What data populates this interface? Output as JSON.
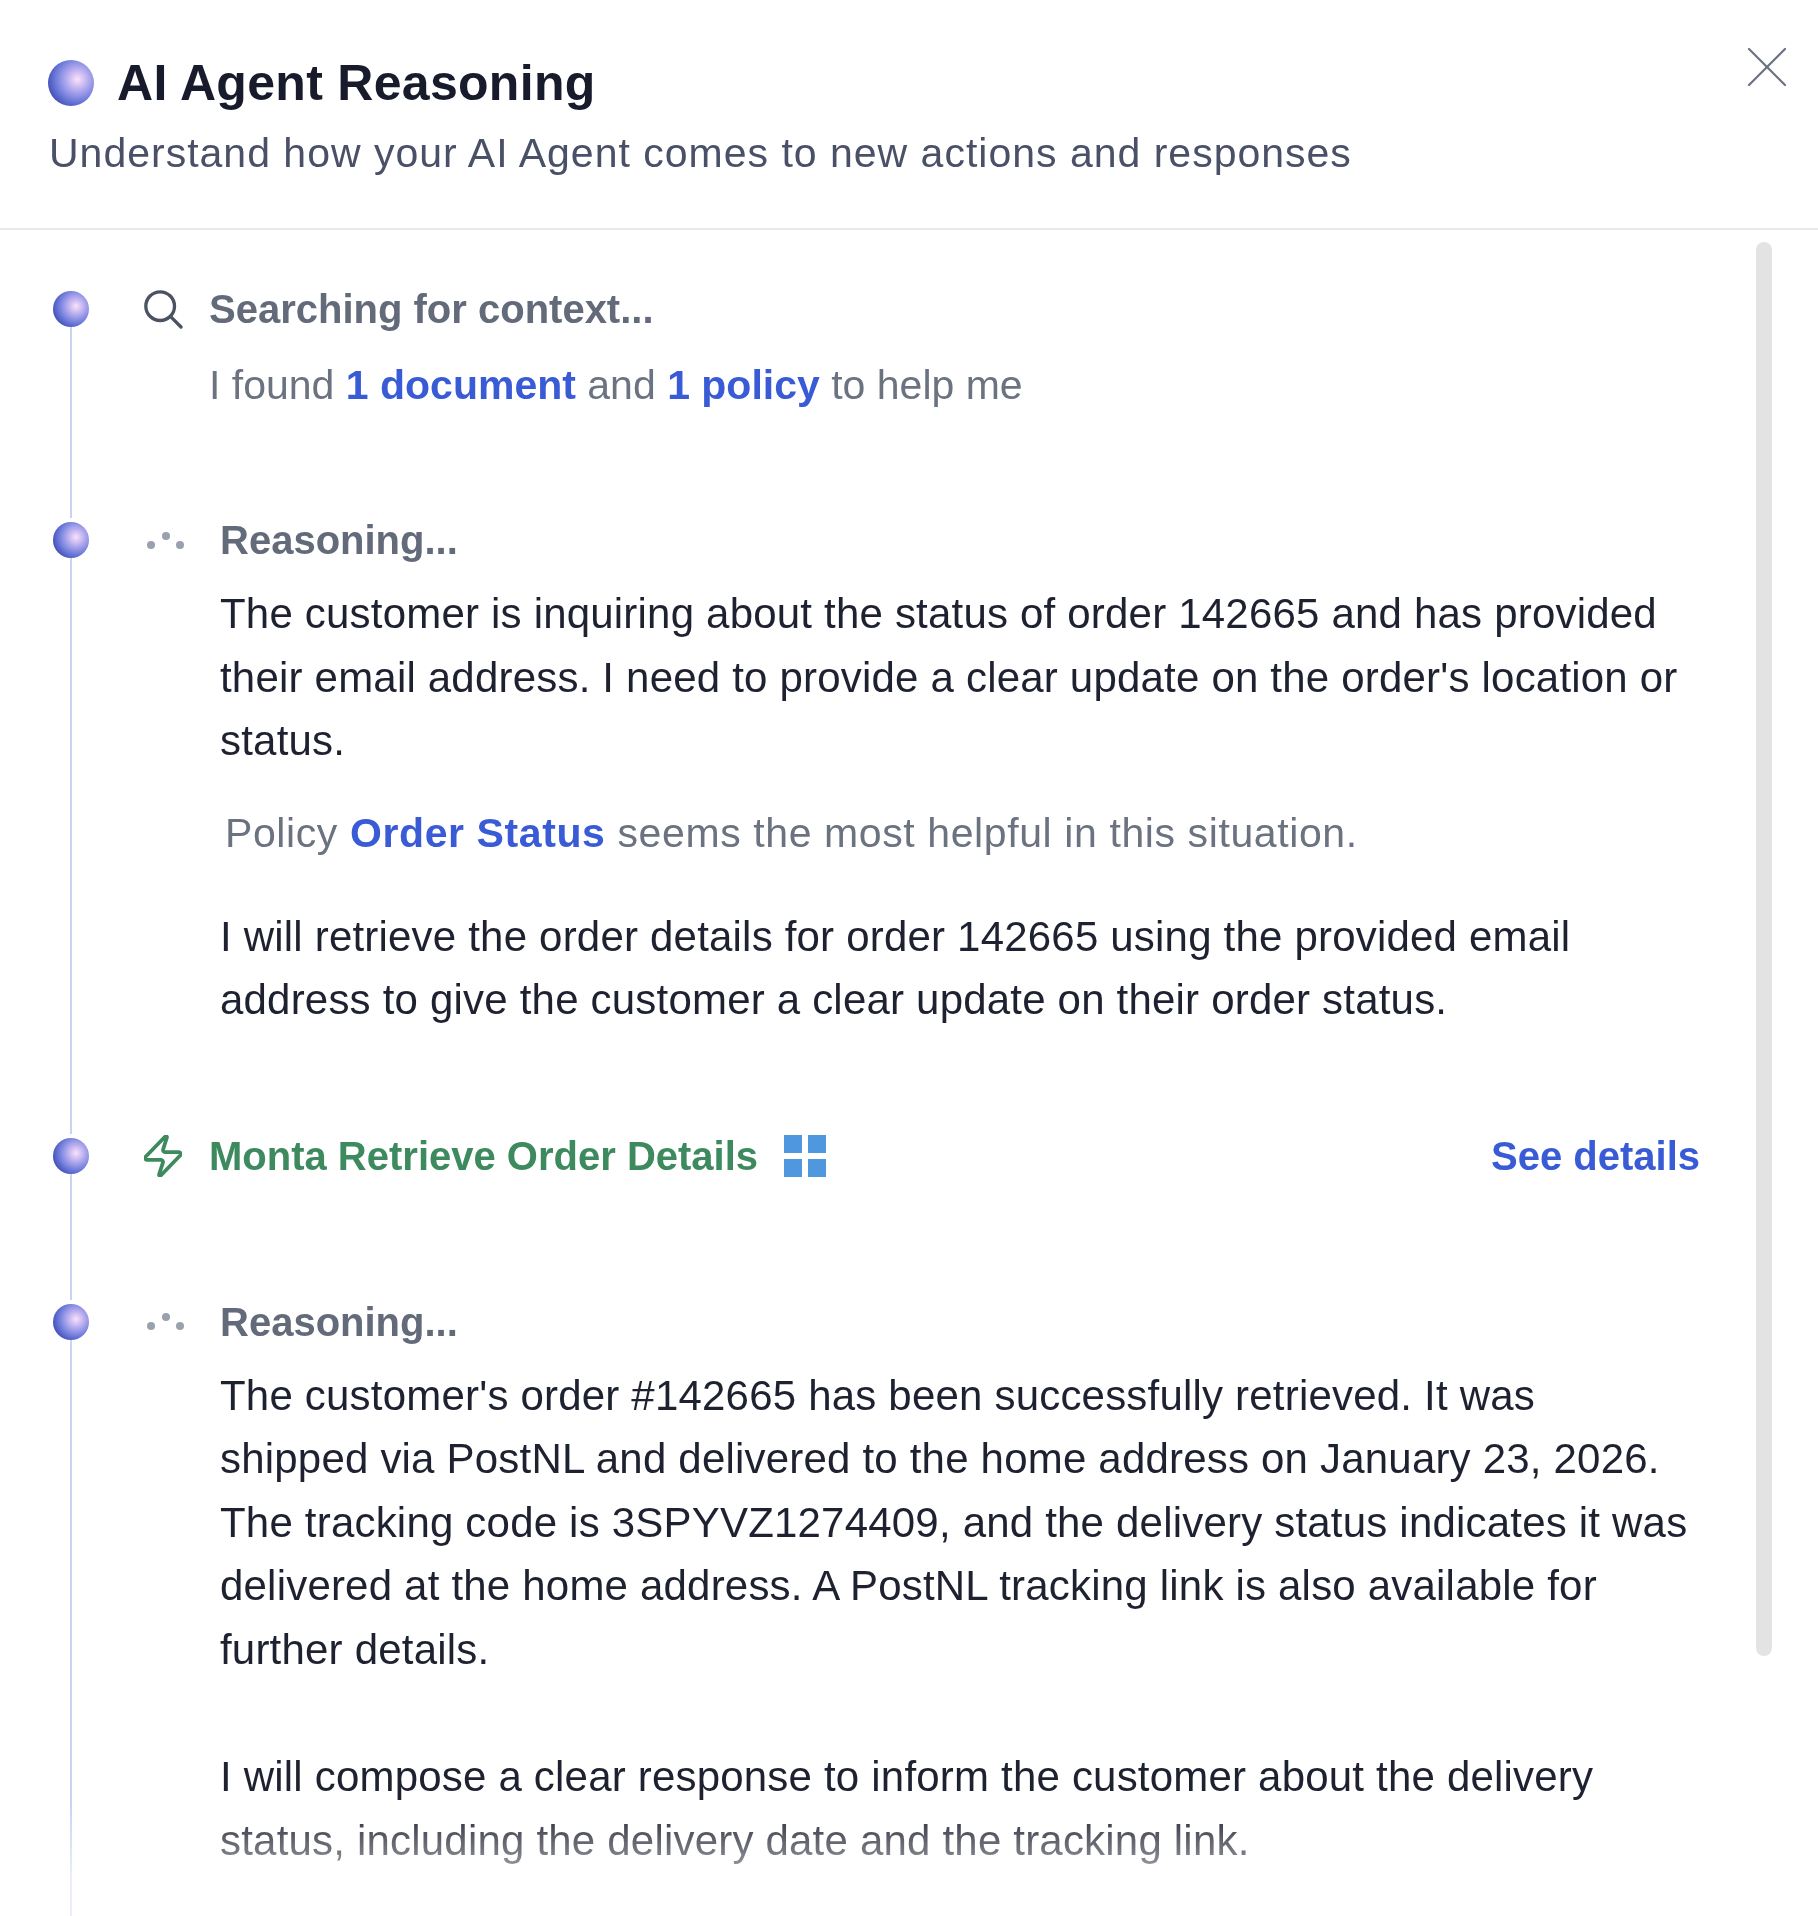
{
  "header": {
    "title": "AI Agent Reasoning",
    "subtitle": "Understand how your AI Agent comes to new actions and responses"
  },
  "steps": [
    {
      "kind": "search",
      "title": "Searching for context...",
      "summary": [
        {
          "kind": "text",
          "text": "I found"
        },
        {
          "kind": "link",
          "text": "1 document"
        },
        {
          "kind": "text",
          "text": "and"
        },
        {
          "kind": "link",
          "text": "1 policy"
        },
        {
          "kind": "text",
          "text": "to help me"
        }
      ]
    },
    {
      "kind": "reasoning",
      "title": "Reasoning...",
      "blocks": [
        {
          "kind": "paragraph",
          "text": "The customer is inquiring about the status of order 142665 and has provided their email address. I need to provide a clear update on the order's location or status."
        },
        {
          "kind": "policy",
          "parts": [
            {
              "kind": "text",
              "text": "Policy"
            },
            {
              "kind": "link",
              "text": "Order Status"
            },
            {
              "kind": "text",
              "text": "seems the most helpful in this situation."
            }
          ]
        },
        {
          "kind": "paragraph",
          "text": "I will retrieve the order details for order 142665 using the provided email address to give the customer a clear update on their order status."
        }
      ]
    },
    {
      "kind": "action",
      "title": "Monta Retrieve Order Details",
      "link": "See details"
    },
    {
      "kind": "reasoning",
      "title": "Reasoning...",
      "blocks": [
        {
          "kind": "paragraph",
          "text": "The customer's order #142665 has been successfully retrieved. It was shipped via PostNL and delivered to the home address on January 23, 2026. The tracking code is 3SPYVZ1274409, and the delivery status indicates it was delivered at the home address. A PostNL tracking link is also available for further details."
        },
        {
          "kind": "paragraph",
          "text": "I will compose a clear response to inform the customer about the delivery status, including the delivery date and the tracking link."
        }
      ]
    }
  ]
}
